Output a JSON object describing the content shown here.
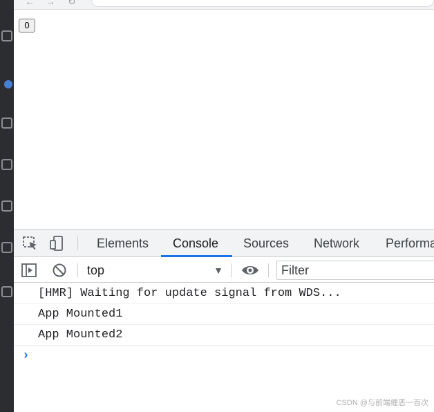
{
  "page": {
    "counter_value": "0"
  },
  "devtools": {
    "tabs": [
      {
        "label": "Elements",
        "active": false
      },
      {
        "label": "Console",
        "active": true
      },
      {
        "label": "Sources",
        "active": false
      },
      {
        "label": "Network",
        "active": false
      },
      {
        "label": "Performa",
        "active": false
      }
    ],
    "context": "top",
    "filter_placeholder": "Filter",
    "accent_color": "#1a73e8"
  },
  "console": {
    "messages": [
      "[HMR] Waiting for update signal from WDS...",
      "App Mounted1",
      "App Mounted2"
    ],
    "prompt_symbol": "›"
  },
  "watermark": "CSDN @与前端缠恶一百次"
}
